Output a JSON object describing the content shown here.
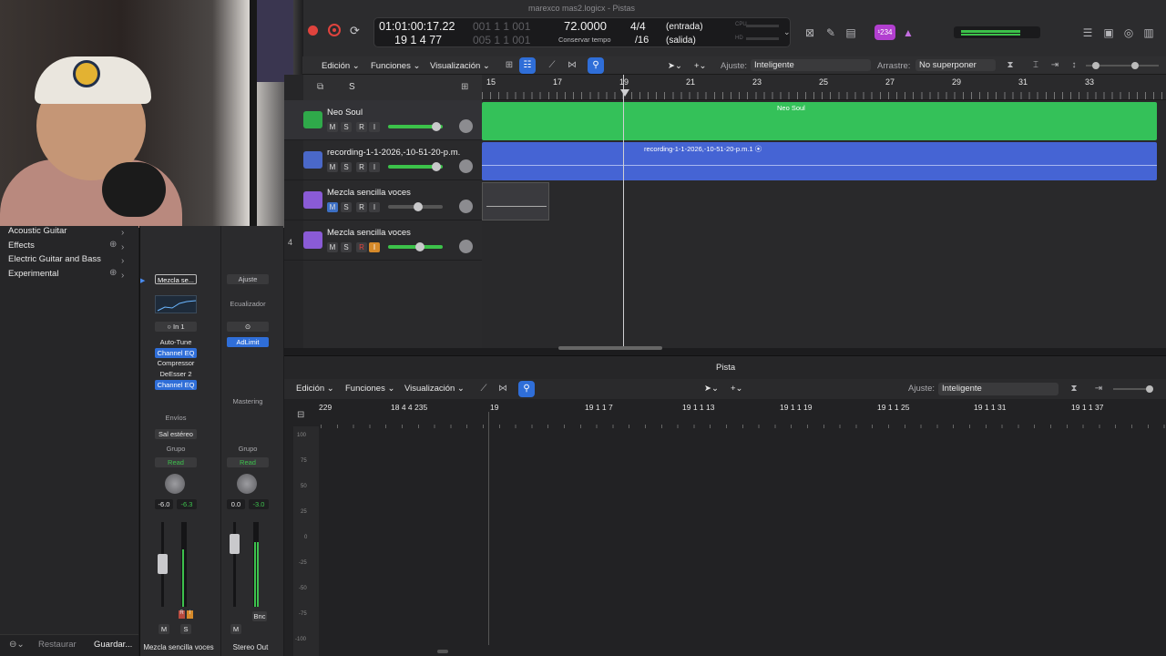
{
  "window": {
    "title": "marexco mas2.logicx - Pistas"
  },
  "lcd": {
    "time": "01:01:00:17.22",
    "bars_dim": "001 1 1 001",
    "bars": "19 1 4 77",
    "bars2_dim": "005 1 1 001",
    "tempo": "72.0000",
    "tempo_label": "Conservar tempo",
    "sig_top": "4/4",
    "sig_bottom": "/16",
    "in_label": "(entrada)",
    "out_label": "(salida)",
    "cpu_label": "CPU",
    "hd_label": "HD"
  },
  "badge": {
    "text": "¹234"
  },
  "toolbar": {
    "edit": "Edición",
    "functions": "Funciones",
    "view": "Visualización",
    "snap_label": "Ajuste:",
    "snap_value": "Inteligente",
    "drag_label": "Arrastre:",
    "drag_value": "No superponer"
  },
  "library": {
    "items": [
      "Acoustic Guitar",
      "Effects",
      "Electric Guitar and Bass",
      "Experimental"
    ],
    "restore": "Restaurar",
    "save": "Guardar..."
  },
  "inspector": {
    "left": {
      "preset": "Mezcla se...",
      "input": "In 1",
      "plugins": [
        "Auto-Tune",
        "Channel EQ",
        "Compressor",
        "DeEsser 2",
        "Channel EQ"
      ],
      "sends": "Envíos",
      "output": "Sal estéreo",
      "group": "Grupo",
      "automation": "Read",
      "vol": "-6.0",
      "peak": "-6.3",
      "mute": "M",
      "solo": "S",
      "name": "Mezcla sencilla voces"
    },
    "right": {
      "setting": "Ajuste",
      "eq": "Ecualizador",
      "plugin": "AdLimit",
      "mastering": "Mastering",
      "group": "Grupo",
      "automation": "Read",
      "vol": "0.0",
      "peak": "-3.0",
      "mute": "M",
      "bounce": "Bnc",
      "name": "Stereo Out"
    }
  },
  "header_buttons": {
    "solo": "S"
  },
  "tracks": [
    {
      "name": "Neo Soul",
      "number": "",
      "color": "#2fa94a",
      "volume": 0.85
    },
    {
      "name": "recording-1-1-2026,-10-51-20-p.m.",
      "number": "",
      "color": "#3f5fc8",
      "volume": 0.85
    },
    {
      "name": "Mezcla sencilla voces",
      "number": "",
      "color": "#8a5bd6",
      "volume": 0.55
    },
    {
      "name": "Mezcla sencilla voces",
      "number": "4",
      "color": "#8a5bd6",
      "volume": 0.6
    }
  ],
  "track_buttons": {
    "m": "M",
    "s": "S",
    "r": "R",
    "i": "I"
  },
  "ruler": [
    "15",
    "17",
    "19",
    "21",
    "23",
    "25",
    "27",
    "29",
    "31",
    "33"
  ],
  "regions": {
    "neo": "Neo Soul",
    "rec": "recording-1-1-2026,-10-51-20-p.m.1 ⦿"
  },
  "editor": {
    "title": "Pista",
    "edit": "Edición",
    "functions": "Funciones",
    "view": "Visualización",
    "snap_label": "Ajuste:",
    "snap_value": "Inteligente",
    "ruler": [
      "229",
      "18 4 4 235",
      "19",
      "19 1 1 7",
      "19 1 1 13",
      "19 1 1 19",
      "19 1 1 25",
      "19 1 1 31",
      "19 1 1 37"
    ],
    "yaxis": [
      "100",
      "75",
      "50",
      "25",
      "0",
      "-25",
      "-50",
      "-75",
      "-100"
    ]
  },
  "icons": [
    "record-icon",
    "cycle-icon",
    "pointer-tool-icon",
    "library-icon",
    "metronome-icon"
  ]
}
